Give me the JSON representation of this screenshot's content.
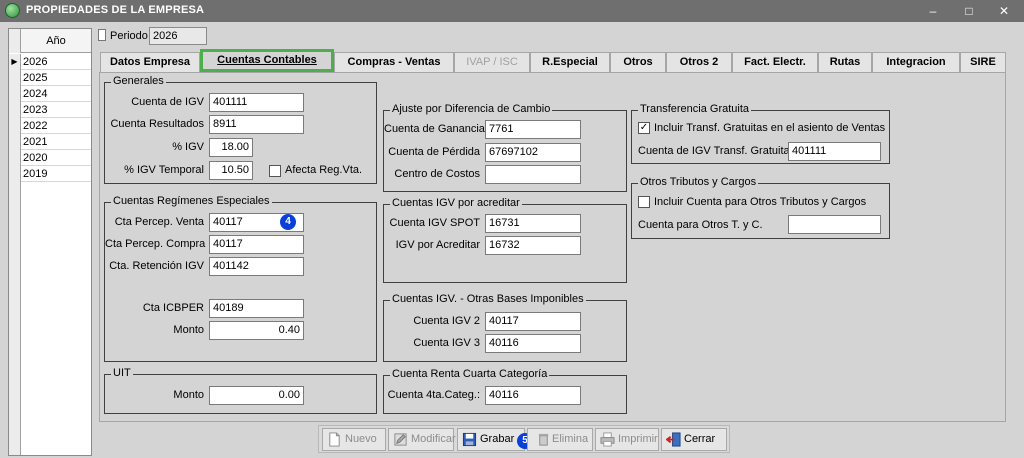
{
  "window": {
    "title": "PROPIEDADES DE LA EMPRESA"
  },
  "year_grid": {
    "header": "Año",
    "years": [
      "2026",
      "2025",
      "2024",
      "2023",
      "2022",
      "2021",
      "2020",
      "2019"
    ],
    "selected": "2026"
  },
  "periodo": {
    "label": "Periodo",
    "value": "2026"
  },
  "tabs": [
    {
      "label": "Datos Empresa",
      "state": "normal"
    },
    {
      "label": "Cuentas Contables",
      "state": "active"
    },
    {
      "label": "Compras - Ventas",
      "state": "normal"
    },
    {
      "label": "IVAP / ISC",
      "state": "disabled"
    },
    {
      "label": "R.Especial",
      "state": "normal"
    },
    {
      "label": "Otros",
      "state": "normal"
    },
    {
      "label": "Otros 2",
      "state": "normal"
    },
    {
      "label": "Fact. Electr.",
      "state": "normal"
    },
    {
      "label": "Rutas",
      "state": "normal"
    },
    {
      "label": "Integracion",
      "state": "normal"
    },
    {
      "label": "SIRE",
      "state": "normal"
    }
  ],
  "generales": {
    "title": "Generales",
    "cuenta_igv": {
      "label": "Cuenta de IGV",
      "value": "401111"
    },
    "cuenta_resultados": {
      "label": "Cuenta Resultados",
      "value": "8911"
    },
    "pct_igv": {
      "label": "% IGV",
      "value": "18.00"
    },
    "pct_igv_temporal": {
      "label": "% IGV Temporal",
      "value": "10.50"
    },
    "afecta_reg_vta": {
      "label": "Afecta Reg.Vta.",
      "checked": false
    }
  },
  "regimenes": {
    "title": "Cuentas Regímenes Especiales",
    "cta_percep_venta": {
      "label": "Cta Percep. Venta",
      "value": "40117"
    },
    "cta_percep_compra": {
      "label": "Cta Percep. Compra",
      "value": "40117"
    },
    "cta_retencion_igv": {
      "label": "Cta. Retención IGV",
      "value": "401142"
    },
    "cta_icbper": {
      "label": "Cta ICBPER",
      "value": "40189"
    },
    "monto": {
      "label": "Monto",
      "value": "0.40"
    }
  },
  "uit": {
    "title": "UIT",
    "monto": {
      "label": "Monto",
      "value": "0.00"
    }
  },
  "ajuste": {
    "title": "Ajuste por Diferencia de Cambio",
    "ganancia": {
      "label": "Cuenta de Ganancia",
      "value": "7761"
    },
    "perdida": {
      "label": "Cuenta de Pérdida",
      "value": "67697102"
    },
    "centro_costos": {
      "label": "Centro de Costos",
      "value": ""
    }
  },
  "igv_acreditar": {
    "title": "Cuentas IGV por acreditar",
    "spot": {
      "label": "Cuenta IGV SPOT",
      "value": "16731"
    },
    "por_acreditar": {
      "label": "IGV por Acreditar",
      "value": "16732"
    }
  },
  "otras_bases": {
    "title": "Cuentas IGV. - Otras Bases Imponibles",
    "igv2": {
      "label": "Cuenta IGV 2",
      "value": "40117"
    },
    "igv3": {
      "label": "Cuenta IGV 3",
      "value": "40116"
    }
  },
  "renta_cuarta": {
    "title": "Cuenta Renta Cuarta Categoría",
    "cuenta": {
      "label": "Cuenta 4ta.Categ.:",
      "value": "40116"
    }
  },
  "transferencia": {
    "title": "Transferencia Gratuita",
    "incluir": {
      "label": "Incluir Transf. Gratuitas en el asiento de Ventas",
      "checked": true
    },
    "cuenta_igv": {
      "label": "Cuenta de IGV Transf. Gratuita",
      "value": "401111"
    }
  },
  "otros_tributos": {
    "title": "Otros Tributos y Cargos",
    "incluir": {
      "label": "Incluir Cuenta para Otros Tributos y Cargos",
      "checked": false
    },
    "cuenta": {
      "label": "Cuenta para Otros T. y C.",
      "value": ""
    }
  },
  "badges": {
    "percep_venta": "4",
    "grabar": "5"
  },
  "toolbar": {
    "nuevo": "Nuevo",
    "modificar": "Modificar",
    "grabar": "Grabar",
    "elimina": "Elimina",
    "imprimir": "Imprimir",
    "cerrar": "Cerrar"
  },
  "colors": {
    "active_tab_border": "#4cae4c",
    "badge": "#0a3fd8",
    "titlebar": "#6f6f6f"
  }
}
